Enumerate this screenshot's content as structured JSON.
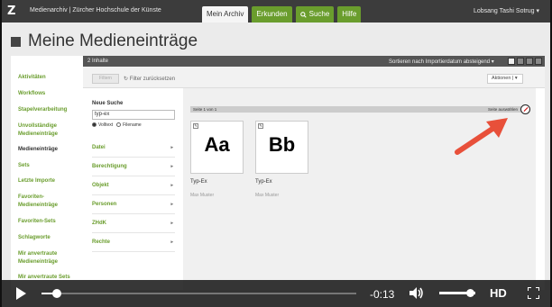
{
  "topbar": {
    "logo": "Z",
    "site_title": "Medienarchiv | Zürcher Hochschule der Künste",
    "tabs": [
      {
        "label": "Mein Archiv",
        "active": true
      },
      {
        "label": "Erkunden",
        "active": false
      },
      {
        "label": "Suche",
        "active": false,
        "icon": "search-icon"
      },
      {
        "label": "Hilfe",
        "active": false
      }
    ],
    "user": "Lobsang Tashi Sotrug ▾"
  },
  "page": {
    "title": "Meine Medieneinträge"
  },
  "sidebar": {
    "items": [
      {
        "label": "Aktivitäten",
        "active": false
      },
      {
        "label": "Workflows",
        "active": false
      },
      {
        "label": "Stapelverarbeitung",
        "active": false
      },
      {
        "label": "Unvollständige Medieneinträge",
        "active": false
      },
      {
        "label": "Medieneinträge",
        "active": true
      },
      {
        "label": "Sets",
        "active": false
      },
      {
        "label": "Letzte Importe",
        "active": false
      },
      {
        "label": "Favoriten-Medieneinträge",
        "active": false
      },
      {
        "label": "Favoriten-Sets",
        "active": false
      },
      {
        "label": "Schlagworte",
        "active": false
      },
      {
        "label": "Mir anvertraute Medieneinträge",
        "active": false
      },
      {
        "label": "Mir anvertraute Sets",
        "active": false
      }
    ]
  },
  "main": {
    "count": "2 Inhalte",
    "sort": "Sortieren nach Importierdatum absteigend ▾",
    "filter_button": "Filtern",
    "reset": "Filter zurücksetzen",
    "actions": "Aktionen",
    "search": {
      "label": "Neue Suche",
      "value": "typ-ex",
      "options": [
        {
          "label": "Volltext",
          "selected": true
        },
        {
          "label": "Filename",
          "selected": false
        }
      ]
    },
    "facets": [
      "Datei",
      "Berechtigung",
      "Objekt",
      "Personen",
      "ZHdK",
      "Rechte"
    ],
    "pager_left": "Seite 1 von 1",
    "pager_right": "Seite auswählen",
    "items": [
      {
        "glyph": "Aa",
        "name": "Typ-Ex",
        "author": "Max Muster"
      },
      {
        "glyph": "Bb",
        "name": "Typ-Ex",
        "author": "Max Muster"
      }
    ]
  },
  "player": {
    "time": "-0:13",
    "hd": "HD",
    "progress": 0.05,
    "volume": 0.85
  }
}
